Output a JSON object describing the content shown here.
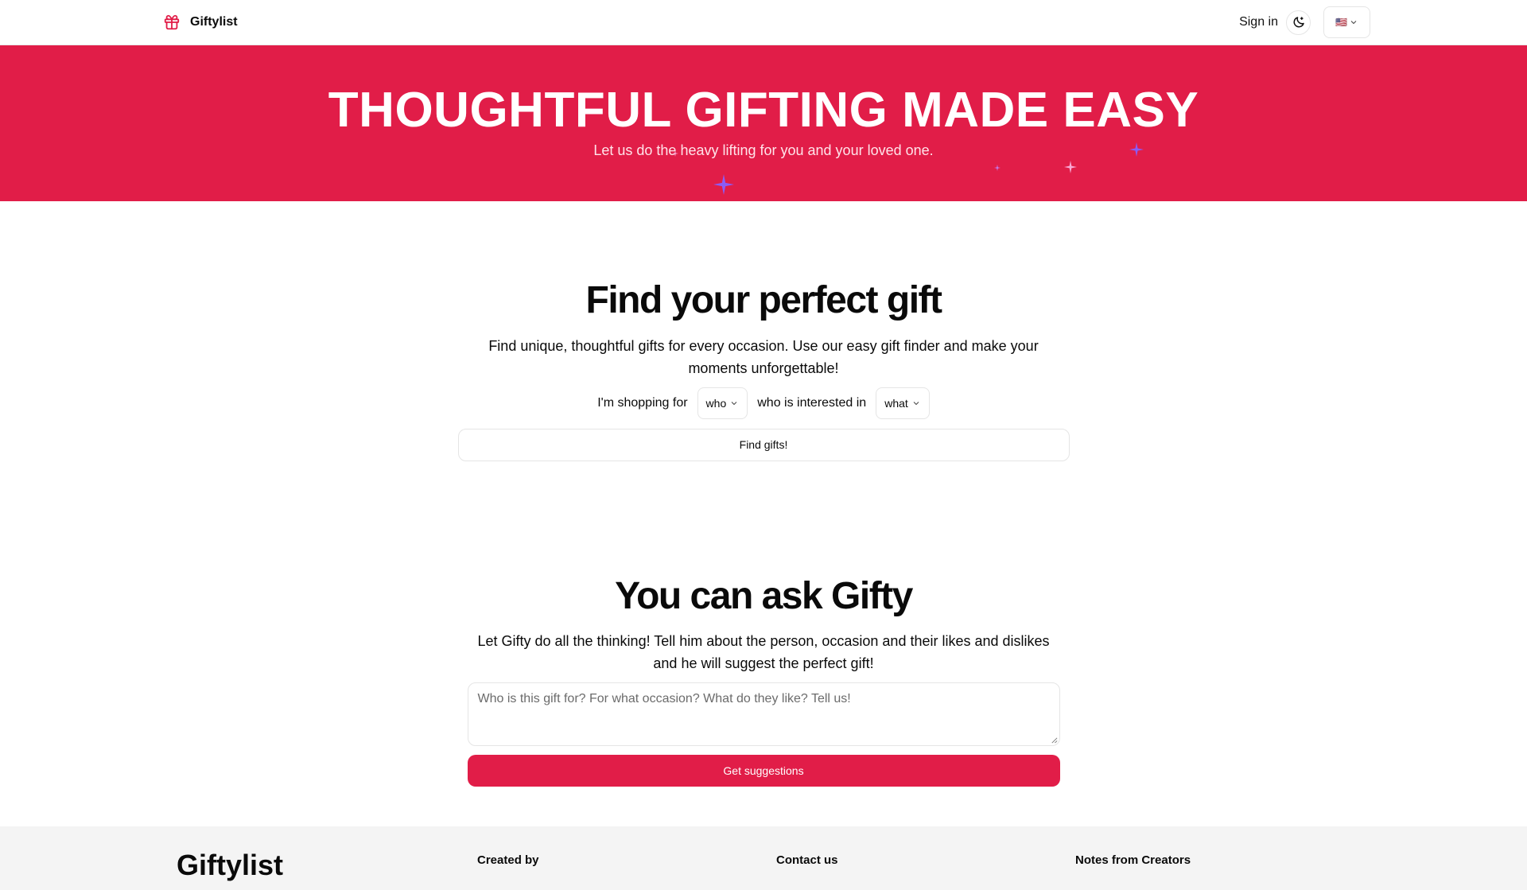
{
  "header": {
    "brand": "Giftylist",
    "sign_in": "Sign in",
    "language_flag": "🇺🇸"
  },
  "hero": {
    "title": "THOUGHTFUL GIFTING MADE EASY",
    "subtitle": "Let us do the heavy lifting for you and your loved one."
  },
  "finder": {
    "title": "Find your perfect gift",
    "description": "Find unique, thoughtful gifts for every occasion. Use our easy gift finder and make your moments unforgettable!",
    "shopping_for_label": "I'm shopping for",
    "who_value": "who",
    "interested_label": "who is interested in",
    "what_value": "what",
    "button": "Find gifts!"
  },
  "gifty": {
    "title": "You can ask Gifty",
    "description": "Let Gifty do all the thinking! Tell him about the person, occasion and their likes and dislikes and he will suggest the perfect gift!",
    "placeholder": "Who is this gift for? For what occasion? What do they like? Tell us!",
    "button": "Get suggestions"
  },
  "footer": {
    "logo": "Giftylist",
    "col_created": "Created by",
    "col_contact": "Contact us",
    "col_notes": "Notes from Creators"
  },
  "colors": {
    "accent": "#e11d48",
    "sparkle_purple": "#8b5cf6",
    "sparkle_pink": "#f9a8d4"
  }
}
